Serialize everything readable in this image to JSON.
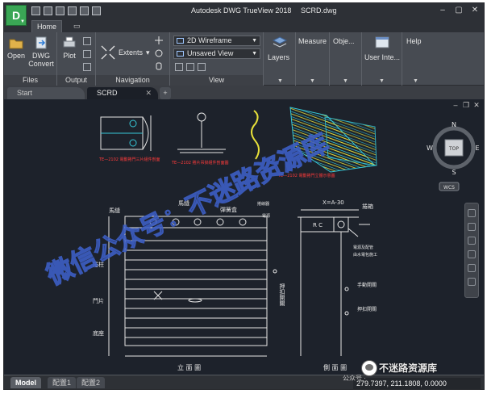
{
  "app": {
    "button_label": "D",
    "title": "Autodesk DWG TrueView 2018",
    "filename": "SCRD.dwg"
  },
  "ribbon": {
    "tabs": [
      "Home"
    ],
    "panels": {
      "files": {
        "title": "Files",
        "open": "Open",
        "dwg_convert_1": "DWG",
        "dwg_convert_2": "Convert"
      },
      "output": {
        "title": "Output",
        "plot": "Plot"
      },
      "navigation": {
        "title": "Navigation",
        "extents": "Extents"
      },
      "view": {
        "title": "View",
        "visual_style": "2D Wireframe",
        "named_view": "Unsaved View"
      },
      "layers": "Layers",
      "measure": "Measure",
      "objects": "Obje...",
      "user_interface": "User Inte...",
      "help": "Help"
    }
  },
  "doc_tabs": {
    "start": "Start",
    "drawing": "SCRD",
    "plus": "+"
  },
  "viewcube": {
    "north": "N",
    "south": "S",
    "east": "E",
    "west": "W",
    "top": "TOP",
    "wcs": "WCS"
  },
  "drawing_labels": {
    "detail1": "TE—2102 電動捲門三片組件剖面",
    "detail2": "TE—2102 捲片吊掛組件剖面圖",
    "detail3": "TE—2102 電動捲門立體示意圖",
    "mafeng_left": "馬縫",
    "mafeng_mid": "馬縫",
    "spring_box": "彈簧盒",
    "motor": "捲線器",
    "wire_box": "電源",
    "zhuzhu": "捲柱",
    "menpian": "門片",
    "dizuo": "底座",
    "switch_v": "押扣開關",
    "front_title": "立 面 圖",
    "dim_top": "X=A-30",
    "dim_rc": "R C",
    "juanxiang": "捲箱",
    "power_note1": "電源及配管",
    "power_note2": "由水電包施工",
    "manual_switch": "手動開關",
    "push_switch": "押扣開關",
    "side_title": "側 面 圖"
  },
  "layout_tabs": [
    "Model",
    "配置1",
    "配置2"
  ],
  "status": {
    "coordinates": "279.7397, 211.1808, 0.0000"
  },
  "watermark": {
    "corner_text": "不迷路资源库",
    "small_text": "公众号 ·",
    "diagonal_text": "微信公众号：不迷路资源库"
  },
  "colors": {
    "drawing_bg": "#1d222b",
    "line_white": "#e6e6e6",
    "line_cyan": "#36c8d8",
    "line_yellow": "#e8e13a",
    "text_red": "#ff3b3b",
    "watermark_blue": "#3d5ec4"
  }
}
